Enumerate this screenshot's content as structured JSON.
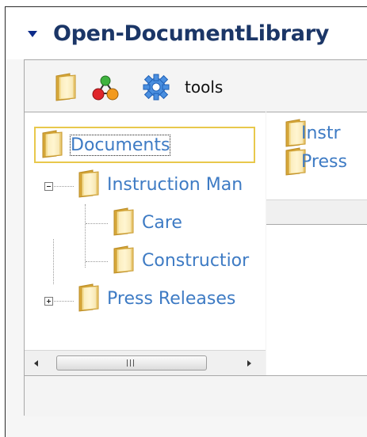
{
  "header": {
    "title": "Open-DocumentLibrary"
  },
  "toolbar": {
    "tools_label": "tools",
    "icons": [
      "folder-icon",
      "hierarchy-icon",
      "gear-icon"
    ]
  },
  "tree": {
    "root": {
      "label": "Documents"
    },
    "items": [
      {
        "label": "Instruction Man",
        "expanded": true,
        "children": [
          {
            "label": "Care"
          },
          {
            "label": "Constructior"
          }
        ]
      },
      {
        "label": "Press Releases",
        "expanded": false
      }
    ]
  },
  "scrollbar": {
    "grip": "III"
  },
  "list": {
    "items": [
      {
        "label": "Instr"
      },
      {
        "label": "Press"
      }
    ]
  },
  "colors": {
    "link": "#3e7bc4",
    "title": "#1b3667",
    "arrow": "#0d2c8a",
    "selection_border": "#e8c84c"
  }
}
